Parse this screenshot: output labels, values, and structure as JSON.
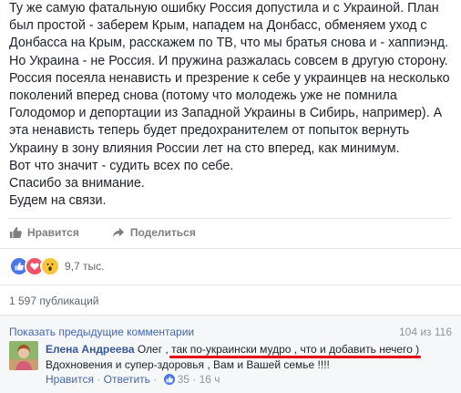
{
  "post": {
    "lines": [
      "Ту же самую фатальную ошибку Россия допустила и с Украиной. План",
      "был простой - заберем Крым, нападем на Донбасс, обменяем уход с",
      "Донбасса на Крым, расскажем по ТВ, что мы братья снова и - хаппиэнд.",
      "Но Украина - не Россия. И пружина разжалась совсем в другую сторону.",
      "Россия посеяла ненависть и презрение к себе у украинцев на несколько",
      "поколений вперед снова (потому что молодежь уже не помнила",
      "Голодомор и депортации из Западной Украины в Сибирь, например). А",
      "эта ненависть теперь будет предохранителем от попыток вернуть",
      "Украину в зону влияния России лет на сто вперед, как минимум.",
      "Вот что значит - судить всех по себе.",
      "Спасибо за внимание.",
      "Будем на связи."
    ]
  },
  "actions": {
    "like_label": "Нравится",
    "share_label": "Поделиться"
  },
  "reactions": {
    "count": "9,7 тыс."
  },
  "shares": {
    "label": "1 597 публикаций"
  },
  "comments": {
    "show_previous": "Показать предыдущие комментарии",
    "count_text": "104 из 116",
    "items": [
      {
        "author": "Елена Андреева",
        "text_line1": "Олег , так по-украински мудро , что и добавить нечего )",
        "text_line2": "Вдохновения и супер-здоровья , Вам и Вашей семье !!!!",
        "like_label": "Нравится",
        "reply_label": "Ответить",
        "likes": "35",
        "time": "16 ч"
      }
    ]
  },
  "colors": {
    "link": "#365899",
    "like_blue": "#4a76e8",
    "love_red": "#f25268",
    "wow_yellow": "#f7c53a",
    "highlight_underline": "#e2001a"
  }
}
